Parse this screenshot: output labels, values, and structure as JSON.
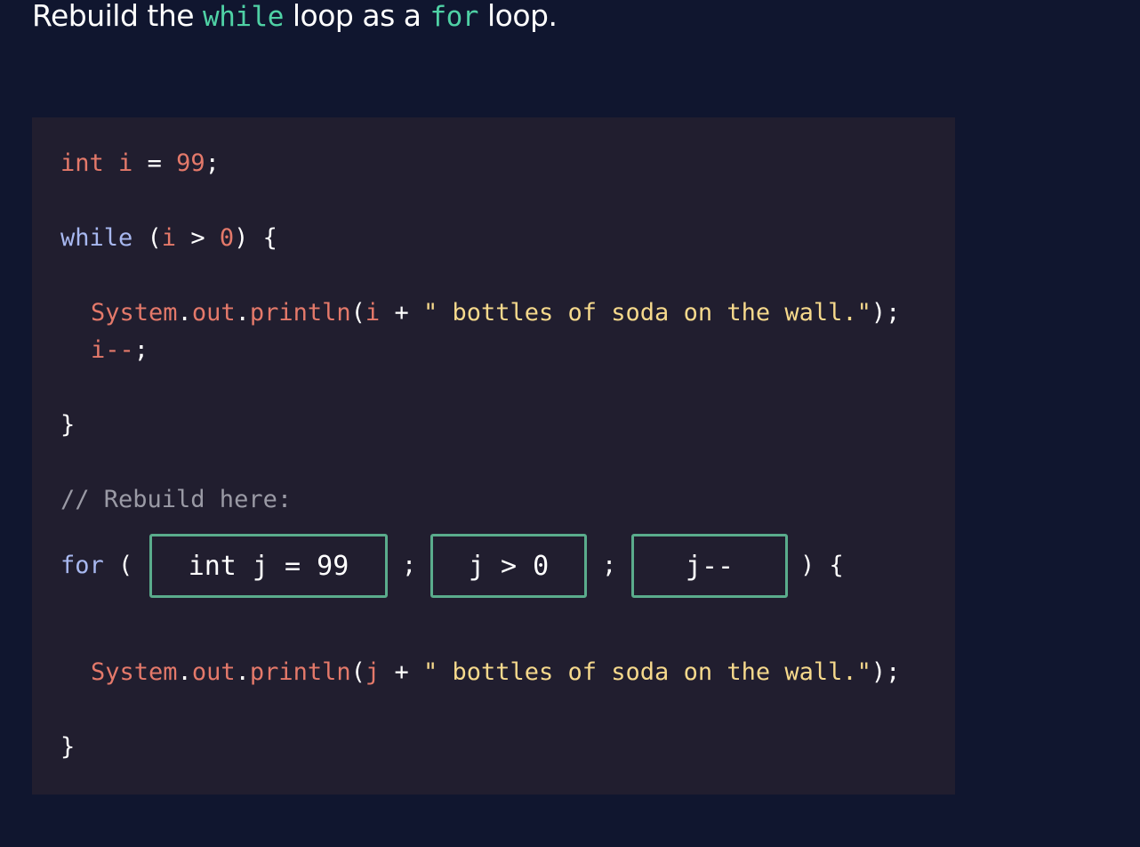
{
  "prompt": {
    "before": "Rebuild the ",
    "kw1": "while",
    "middle": " loop as a ",
    "kw2": "for",
    "after": " loop."
  },
  "code": {
    "decl": {
      "type": "int",
      "name": "i",
      "eq": " = ",
      "value": "99",
      "end": ";"
    },
    "while_line": {
      "keyword": "while",
      "open": " (",
      "var": "i",
      "op": " > ",
      "value": "0",
      "close": ") {"
    },
    "println1": {
      "obj": "System",
      "dot1": ".",
      "field": "out",
      "dot2": ".",
      "method": "println",
      "open": "(",
      "var": "i",
      "plus": " + ",
      "string": "\" bottles of soda on the wall.\"",
      "close": ");"
    },
    "decrement1": {
      "var": "i--",
      "end": ";"
    },
    "close1": "}",
    "comment": "// Rebuild here:",
    "for_line": {
      "keyword": "for",
      "open": " (",
      "sep1": ";",
      "sep2": ";",
      "close": ") {"
    },
    "println2": {
      "obj": "System",
      "dot1": ".",
      "field": "out",
      "dot2": ".",
      "method": "println",
      "open": "(",
      "var": "j",
      "plus": " + ",
      "string": "\" bottles of soda on the wall.\"",
      "close": ");"
    },
    "close2": "}"
  },
  "blanks": {
    "init": "int j = 99",
    "condition": "j > 0",
    "update": "j--"
  },
  "colors": {
    "background": "#10162f",
    "code_panel": "#211e2f",
    "keyword_accent": "#4fd1a5",
    "blank_border": "#5aac8c",
    "code_keyword": "#a8b8f0",
    "code_number": "#e4796a",
    "code_string": "#f6d98c",
    "code_comment": "#9a9aa5"
  }
}
